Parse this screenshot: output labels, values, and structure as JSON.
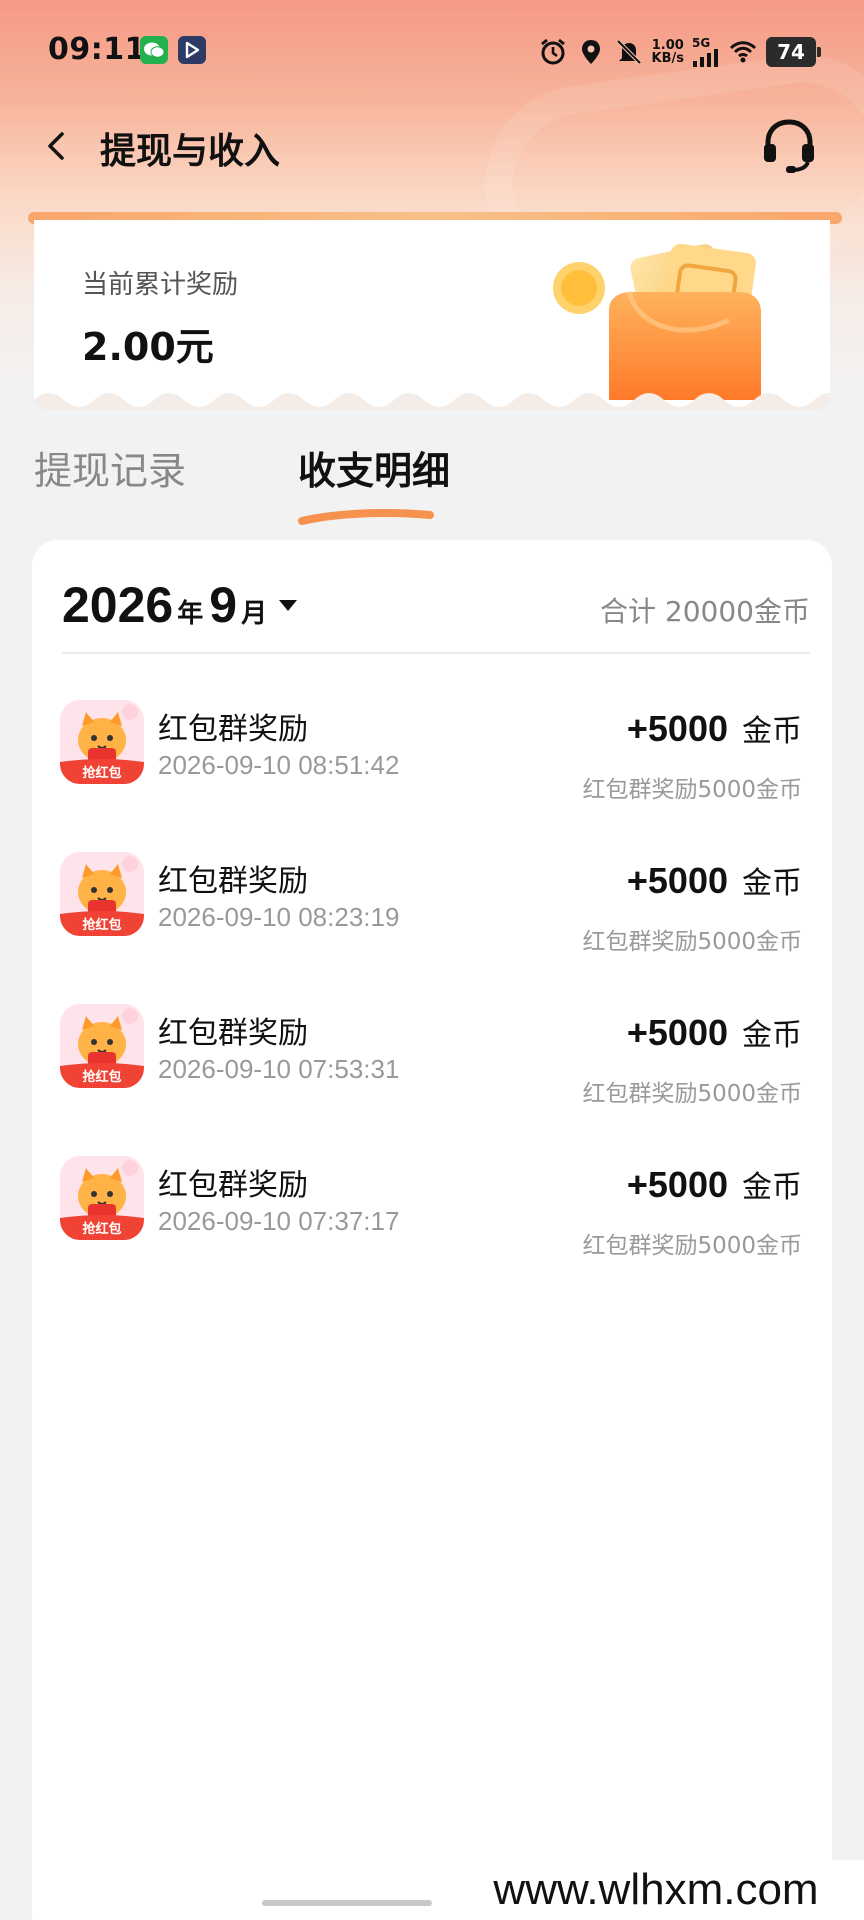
{
  "status_bar": {
    "time": "09:11",
    "speed_value": "1.00",
    "speed_unit": "KB/s",
    "network": "5G",
    "battery": "74",
    "icons": [
      "wechat-icon",
      "play-app-icon",
      "alarm-icon",
      "location-icon",
      "mute-icon",
      "signal-icon",
      "wifi-icon"
    ]
  },
  "nav": {
    "title": "提现与收入",
    "back_icon": "chevron-left-icon",
    "support_icon": "headset-icon"
  },
  "reward": {
    "label": "当前累计奖励",
    "amount": "2.00元"
  },
  "tabs": {
    "withdraw": "提现记录",
    "detail": "收支明细",
    "active": "detail"
  },
  "summary": {
    "year": "2026",
    "year_unit": "年",
    "month": "9",
    "month_unit": "月",
    "total": "合计 20000金币"
  },
  "transactions": [
    {
      "title": "红包群奖励",
      "time": "2026-09-10 08:51:42",
      "amount": "+5000",
      "unit": "金币",
      "desc": "红包群奖励5000金币"
    },
    {
      "title": "红包群奖励",
      "time": "2026-09-10 08:23:19",
      "amount": "+5000",
      "unit": "金币",
      "desc": "红包群奖励5000金币"
    },
    {
      "title": "红包群奖励",
      "time": "2026-09-10 07:53:31",
      "amount": "+5000",
      "unit": "金币",
      "desc": "红包群奖励5000金币"
    },
    {
      "title": "红包群奖励",
      "time": "2026-09-10 07:37:17",
      "amount": "+5000",
      "unit": "金币",
      "desc": "红包群奖励5000金币"
    }
  ],
  "icon_badge": "抢红包",
  "watermark": "www.wlhxm.com",
  "colors": {
    "accent_orange": "#f7a05e",
    "header_gradient_top": "#f59a86"
  }
}
